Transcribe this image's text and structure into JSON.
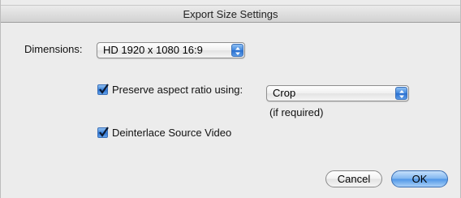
{
  "window": {
    "title": "Export Size Settings"
  },
  "dimensions": {
    "label": "Dimensions:",
    "selected": "HD 1920 x 1080 16:9"
  },
  "preserve_aspect": {
    "label": "Preserve aspect ratio using:",
    "checked": true,
    "selected": "Crop",
    "note": "(if required)"
  },
  "deinterlace": {
    "label": "Deinterlace Source Video",
    "checked": true
  },
  "buttons": {
    "cancel": "Cancel",
    "ok": "OK"
  },
  "colors": {
    "accent": "#3f86de",
    "window_bg": "#ececec"
  }
}
